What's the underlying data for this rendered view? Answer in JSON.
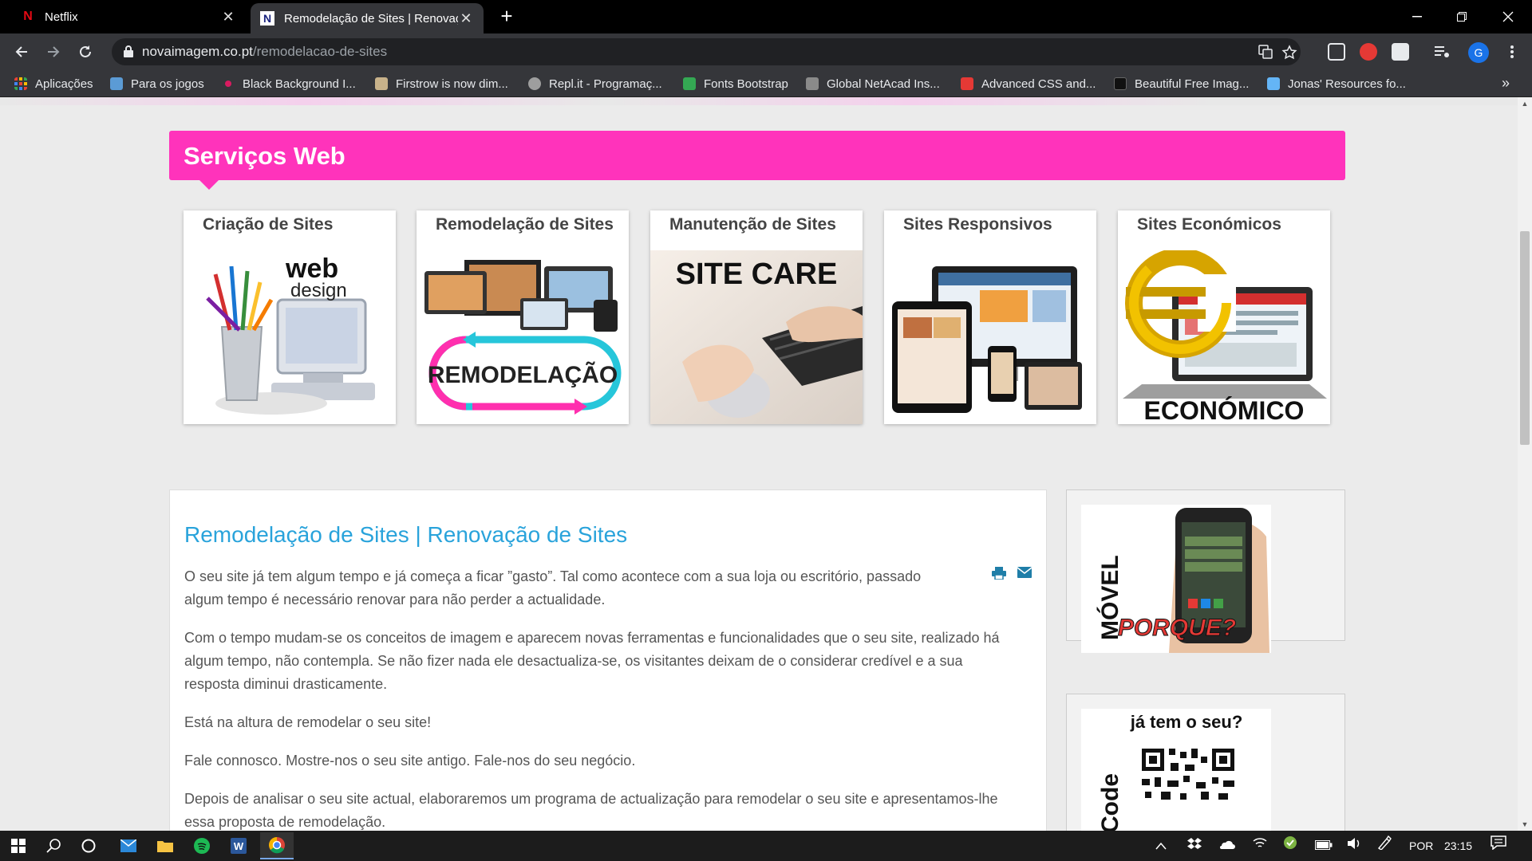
{
  "browser": {
    "tabs": [
      {
        "title": "Netflix",
        "close": "✕"
      },
      {
        "title": "Remodelação de Sites | Renovaçã",
        "close": "✕"
      }
    ],
    "new_tab": "+",
    "url_host": "novaimagem.co.pt",
    "url_path": "/remodelacao-de-sites",
    "profile_initial": "G",
    "bookmarks": [
      {
        "label": "Aplicações",
        "color": "#e94235"
      },
      {
        "label": "Para os jogos",
        "color": "#5b9bd5"
      },
      {
        "label": "Black Background I...",
        "color": "#d81b60"
      },
      {
        "label": "Firstrow is now dim...",
        "color": "#c8b28a"
      },
      {
        "label": "Repl.it - Programaç...",
        "color": "#9e9e9e"
      },
      {
        "label": "Fonts Bootstrap",
        "color": "#34a853"
      },
      {
        "label": "Global NetAcad Ins...",
        "color": "#8a8a8a"
      },
      {
        "label": "Advanced CSS and...",
        "color": "#e53935"
      },
      {
        "label": "Beautiful Free Imag...",
        "color": "#111111"
      },
      {
        "label": "Jonas' Resources fo...",
        "color": "#64b5f6"
      }
    ],
    "more": "»"
  },
  "page": {
    "section_title": "Serviços Web",
    "accent": "#ff33bb",
    "services": [
      {
        "title": "Criação de Sites"
      },
      {
        "title": "Remodelação de Sites"
      },
      {
        "title": "Manutenção de Sites"
      },
      {
        "title": "Sites Responsivos"
      },
      {
        "title": "Sites Económicos"
      }
    ],
    "card_texts": {
      "web": "web",
      "design": "design",
      "remodelacao": "REMODELAÇÃO",
      "site_care": "SITE CARE",
      "economico": "ECONÓMICO",
      "movel": "MÓVEL",
      "porque": "PORQUE?",
      "ja_tem": "já tem o seu?",
      "qr_code": "R Code"
    },
    "article": {
      "title": "Remodelação de Sites | Renovação de Sites",
      "title_color": "#29a3db",
      "paragraphs": [
        "O seu site já tem algum tempo e já começa a ficar ”gasto”. Tal como acontece com a sua loja ou escritório, passado algum tempo é necessário renovar para não perder a actualidade.",
        "Com o tempo mudam-se os conceitos de imagem e aparecem novas ferramentas e funcionalidades que o seu site, realizado há algum tempo, não contempla. Se não fizer nada ele desactualiza-se, os visitantes deixam de o considerar credível e a sua resposta diminui drasticamente.",
        "Está na altura de remodelar o seu site!",
        "Fale connosco. Mostre-nos o seu site antigo. Fale-nos do seu negócio.",
        "Depois de analisar o seu site actual, elaboraremos um programa de actualização para remodelar o seu site e apresentamos-lhe essa proposta de remodelação."
      ]
    }
  },
  "taskbar": {
    "language": "POR",
    "time": "23:15"
  }
}
